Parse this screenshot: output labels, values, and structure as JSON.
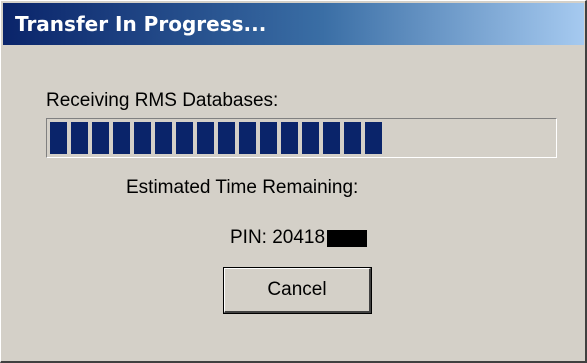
{
  "window": {
    "title": "Transfer In Progress..."
  },
  "status": {
    "label": "Receiving RMS Databases:",
    "progress_fraction": 0.66,
    "filled_blocks": 16,
    "bar_color": "#0a246a"
  },
  "eta": {
    "label": "Estimated Time Remaining:"
  },
  "pin": {
    "text": "PIN: 20418"
  },
  "buttons": {
    "cancel_label": "Cancel"
  },
  "colors": {
    "dialog_bg": "#d4d0c8",
    "title_gradient_start": "#0a246a",
    "title_gradient_end": "#a6caf0"
  }
}
